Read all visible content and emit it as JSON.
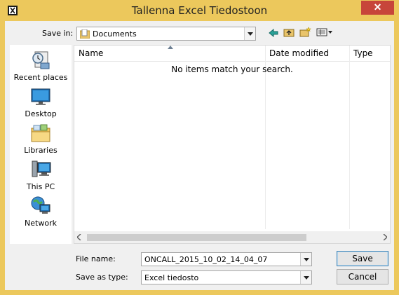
{
  "window": {
    "title": "Tallenna Excel Tiedostoon",
    "close_glyph": "✕"
  },
  "savein": {
    "label": "Save in:",
    "value": "Documents"
  },
  "toolbar": {
    "icons": [
      "back-icon",
      "up-folder-icon",
      "new-folder-icon",
      "view-menu-icon"
    ]
  },
  "places": [
    {
      "label": "Recent places",
      "icon": "recent-places-icon"
    },
    {
      "label": "Desktop",
      "icon": "desktop-icon"
    },
    {
      "label": "Libraries",
      "icon": "libraries-icon"
    },
    {
      "label": "This PC",
      "icon": "this-pc-icon"
    },
    {
      "label": "Network",
      "icon": "network-icon"
    }
  ],
  "list": {
    "columns": [
      "Name",
      "Date modified",
      "Type"
    ],
    "empty_message": "No items match your search."
  },
  "filename": {
    "label": "File name:",
    "value": "ONCALL_2015_10_02_14_04_07"
  },
  "savetype": {
    "label": "Save as type:",
    "value": "Excel tiedosto"
  },
  "buttons": {
    "save": "Save",
    "cancel": "Cancel"
  },
  "colors": {
    "frame": "#ecc85c",
    "close": "#c7453a"
  }
}
